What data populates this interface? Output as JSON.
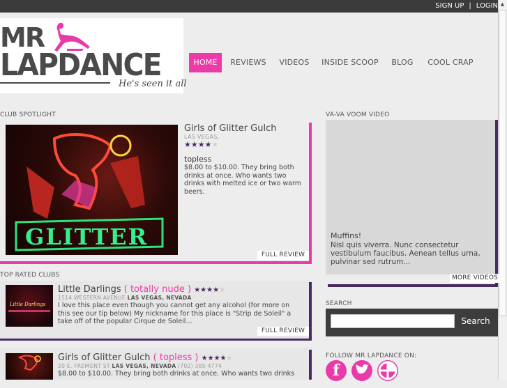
{
  "topbar": {
    "signup": "SIGN UP",
    "separator": "|",
    "login": "LOGIN"
  },
  "logo": {
    "line1": "MR",
    "line2": "LAPDANCE",
    "tagline": "He's seen it all"
  },
  "nav": {
    "items": [
      {
        "label": "HOME",
        "active": true
      },
      {
        "label": "REVIEWS"
      },
      {
        "label": "VIDEOS"
      },
      {
        "label": "INSIDE SCOOP"
      },
      {
        "label": "BLOG"
      },
      {
        "label": "COOL CRAP"
      }
    ]
  },
  "spotlight": {
    "heading": "CLUB SPOTLIGHT",
    "name": "Girls of Glitter Gulch",
    "location": "LAS VEGAS,",
    "stars": "★★★★★",
    "type": "topless",
    "description": "$8.00 to $10.00.  They bring both drinks at once.  Who wants two drinks with melted ice or two warm beers.",
    "full_review": "FULL REVIEW",
    "photo_sign_text": "GLITTER"
  },
  "top_rated": {
    "heading": "TOP RATED CLUBS",
    "clubs": [
      {
        "name": "Little Darlings",
        "type": "( totally nude )",
        "stars": "★★★★★",
        "address_street": "1514 WESTERN AVENUE",
        "address_city": "LAS VEGAS, NEVADA",
        "phone": "",
        "description": "I love this place even though you cannot get any alcohol (for more on this see our tip below) My nickname for this place is \"Strip de Soleil\" a take off of the popular Cirque de Soleil...",
        "full_review": "FULL REVIEW",
        "photo_text": "Little Darlings"
      },
      {
        "name": "Girls of Glitter Gulch",
        "type": "( topless )",
        "stars": "★★★★★",
        "address_street": "20 E. FREMONT ST",
        "address_city": "LAS VEGAS, NEVADA",
        "phone": "(702) 385-4774",
        "description": "$8.00 to $10.00.  They bring both drinks at once.  Who wants two drinks"
      }
    ]
  },
  "video": {
    "heading": "VA-VA VOOM VIDEO",
    "title": "Muffins!",
    "description": "Nisl quis viverra. Nunc consectetur vestibulum faucibus. Aenean tellus urna, pulvinar sed rutrum...",
    "more": "MORE VIDEOS"
  },
  "search": {
    "heading": "SEARCH",
    "button": "Search",
    "value": ""
  },
  "follow": {
    "heading": "FOLLOW MR LAPDANCE ON:",
    "facebook": "f",
    "twitter": "t",
    "other": ""
  },
  "colors": {
    "accent_pink": "#e83aa8",
    "accent_purple": "#4a2a63",
    "topbar": "#3b3b3b"
  }
}
